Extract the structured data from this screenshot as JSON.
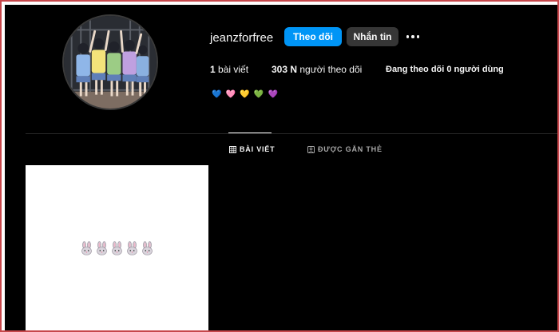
{
  "profile": {
    "username": "jeanzforfree",
    "follow_label": "Theo dõi",
    "message_label": "Nhắn tin",
    "more_icon": "more-horizontal-icon"
  },
  "stats": {
    "posts_count": "1",
    "posts_label": " bài viết",
    "followers_count": "303 N",
    "followers_label": " người theo dõi",
    "following_text": "Đang theo dõi 0 người dùng"
  },
  "bio": {
    "hearts": [
      "💙",
      "🩷",
      "💛",
      "💚",
      "💜"
    ],
    "heart_colors": [
      "#1f6fd6",
      "#ff5fa8",
      "#ffd23a",
      "#19c46a",
      "#a56bf2"
    ]
  },
  "tabs": [
    {
      "label": "BÀI VIẾT",
      "icon": "grid-icon",
      "active": true
    },
    {
      "label": "ĐƯỢC GẮN THẺ",
      "icon": "tagged-icon",
      "active": false
    }
  ],
  "posts": [
    {
      "content": "🐰🐰🐰🐰🐰",
      "bunny_count": 5
    }
  ],
  "colors": {
    "background": "#000000",
    "accent": "#0095f6",
    "secondary_button": "#363636",
    "frame": "#c7474b"
  }
}
